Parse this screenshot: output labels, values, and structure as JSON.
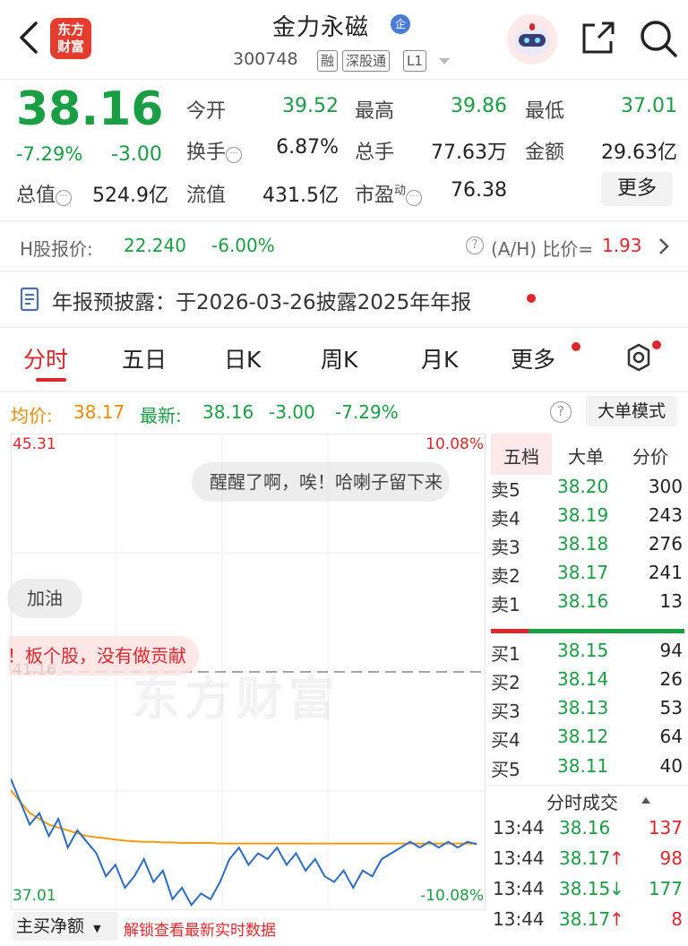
{
  "header": {
    "logo_text_line1": "东方",
    "logo_text_line2": "财富",
    "stock_name": "金力永磁",
    "name_badge": "企",
    "stock_code": "300748",
    "tags": [
      "融",
      "深股通",
      "L1"
    ]
  },
  "quote": {
    "price": "38.16",
    "change_pct": "-7.29%",
    "change": "-3.00",
    "open_label": "今开",
    "open": "39.52",
    "high_label": "最高",
    "high": "39.86",
    "low_label": "最低",
    "low": "37.01",
    "turnover_label": "换手",
    "turnover": "6.87%",
    "volume_label": "总手",
    "volume": "77.63万",
    "amount_label": "金额",
    "amount": "29.63亿",
    "mktcap_label": "总值",
    "mktcap": "524.9亿",
    "float_label": "流值",
    "float": "431.5亿",
    "pe_label": "市盈",
    "pe_sup": "动",
    "pe": "76.38",
    "more_button": "更多"
  },
  "hshare": {
    "label": "H股报价:",
    "price": "22.240",
    "pct": "-6.00%",
    "ah_label": "(A/H) 比价=",
    "ah_value": "1.93"
  },
  "notice": {
    "text": "年报预披露：于2026-03-26披露2025年年报"
  },
  "tabs": [
    "分时",
    "五日",
    "日K",
    "周K",
    "月K",
    "更多"
  ],
  "chart_info": {
    "avg_label": "均价:",
    "avg": "38.17",
    "latest_label": "最新:",
    "latest": "38.16",
    "change": "-3.00",
    "pct": "-7.29%",
    "mode_button": "大单模式"
  },
  "chart_axes": {
    "top_left": "45.31",
    "top_right": "10.08%",
    "mid_left": "41.16",
    "bottom_left": "37.01",
    "bottom_right": "-10.08%"
  },
  "danmaku": {
    "msg1": "醒醒了啊，唉！哈喇子留下来",
    "msg2": "加油",
    "msg3": "板个股，没有做贡献！",
    "watermark": "东方财富"
  },
  "chart_data": {
    "type": "line",
    "title": "",
    "ylim": [
      37.01,
      45.31
    ],
    "prev_close": 41.16,
    "series": [
      {
        "name": "最新",
        "values": [
          39.3,
          38.9,
          38.5,
          38.7,
          38.3,
          38.6,
          38.1,
          38.4,
          38.2,
          38.0,
          37.6,
          37.8,
          37.4,
          37.6,
          37.9,
          37.5,
          37.7,
          37.2,
          37.4,
          37.1,
          37.3,
          37.2,
          37.5,
          37.9,
          38.1,
          37.8,
          38.0,
          37.9,
          38.1,
          37.8,
          38.0,
          37.7,
          37.9,
          37.6,
          37.5,
          37.7,
          37.4,
          37.7,
          37.6,
          37.9,
          38.0,
          38.1,
          38.2,
          38.1,
          38.2,
          38.1,
          38.2,
          38.1,
          38.2,
          38.16
        ]
      },
      {
        "name": "均价",
        "values": [
          39.1,
          38.9,
          38.7,
          38.6,
          38.5,
          38.45,
          38.4,
          38.35,
          38.3,
          38.28,
          38.26,
          38.24,
          38.22,
          38.21,
          38.2,
          38.2,
          38.19,
          38.19,
          38.18,
          38.18,
          38.18,
          38.18,
          38.17,
          38.17,
          38.17,
          38.17,
          38.17,
          38.17,
          38.17,
          38.17,
          38.17,
          38.17,
          38.17,
          38.17,
          38.17,
          38.17,
          38.17,
          38.17,
          38.17,
          38.17,
          38.17,
          38.17,
          38.17,
          38.17,
          38.17,
          38.17,
          38.17,
          38.17,
          38.17,
          38.17
        ]
      }
    ]
  },
  "orderbook": {
    "tabs": [
      "五档",
      "大单",
      "分价"
    ],
    "sell": [
      {
        "label": "卖5",
        "price": "38.20",
        "vol": "300"
      },
      {
        "label": "卖4",
        "price": "38.19",
        "vol": "243"
      },
      {
        "label": "卖3",
        "price": "38.18",
        "vol": "276"
      },
      {
        "label": "卖2",
        "price": "38.17",
        "vol": "241"
      },
      {
        "label": "卖1",
        "price": "38.16",
        "vol": "13"
      }
    ],
    "buy": [
      {
        "label": "买1",
        "price": "38.15",
        "vol": "94"
      },
      {
        "label": "买2",
        "price": "38.14",
        "vol": "26"
      },
      {
        "label": "买3",
        "price": "38.13",
        "vol": "53"
      },
      {
        "label": "买4",
        "price": "38.12",
        "vol": "64"
      },
      {
        "label": "买5",
        "price": "38.11",
        "vol": "40"
      }
    ],
    "ticks_header": "分时成交",
    "ticks": [
      {
        "time": "13:44",
        "price": "38.16",
        "arrow": "",
        "vol": "137",
        "vol_color": "red"
      },
      {
        "time": "13:44",
        "price": "38.17",
        "arrow": "↑",
        "vol": "98",
        "vol_color": "red"
      },
      {
        "time": "13:44",
        "price": "38.15",
        "arrow": "↓",
        "vol": "177",
        "vol_color": "green"
      },
      {
        "time": "13:44",
        "price": "38.17",
        "arrow": "↑",
        "vol": "8",
        "vol_color": "red"
      }
    ]
  },
  "bottom": {
    "dropdown": "主买净额",
    "promo": "解锁查看最新实时数据"
  },
  "colors": {
    "up": "#e0262d",
    "down": "#1a9e44",
    "avg_line": "#f39c12",
    "price_line": "#2b6cc4"
  }
}
